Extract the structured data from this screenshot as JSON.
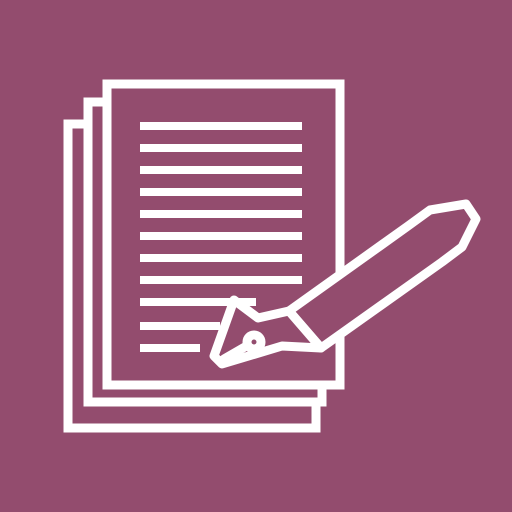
{
  "icon": {
    "name": "document-with-fountain-pen-icon",
    "background_color": "#934c6e",
    "stroke_color": "#ffffff",
    "accent_color": "#934c6e",
    "pages": 3,
    "text_lines": 11
  }
}
